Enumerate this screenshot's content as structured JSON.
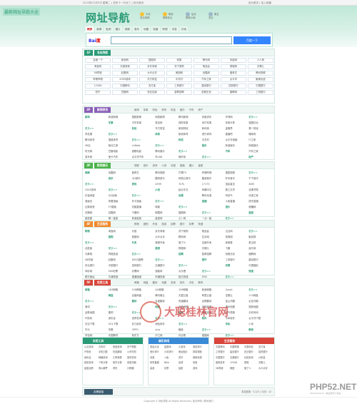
{
  "topbar": {
    "left": "2023年12月5日 星期二 | 农历十一月廿三 | 设为首页",
    "right": "设为首页 | 加入收藏"
  },
  "brand_corner": "最新网址导航大全",
  "title": "网址导航",
  "weather": [
    {
      "day": "今天",
      "desc": "多云转晴"
    },
    {
      "day": "明天",
      "desc": "晴转多云"
    },
    {
      "day": "后天",
      "desc": "阴转小雨"
    },
    {
      "day": "周五",
      "desc": "多云"
    }
  ],
  "nav_tabs": [
    "网页",
    "新闻",
    "贴吧",
    "图片",
    "视频",
    "音乐",
    "地图",
    "知道",
    "购物",
    "问答",
    "外卖"
  ],
  "search": {
    "logo_a": "Bai",
    "logo_b": "度",
    "placeholder": "",
    "button": "百度一下"
  },
  "famous": {
    "no": "1F",
    "title": "名站导航",
    "items": [
      "百度一下",
      "新浪网",
      "搜狐网",
      "网易",
      "腾讯网",
      "凤凰网",
      "人人网",
      "淘宝网",
      "天猫商城",
      "京东商城",
      "苏宁易购",
      "唯品会",
      "携程网",
      "去哪儿",
      "58同城",
      "赶集网",
      "大众点评",
      "美团网",
      "优酷网",
      "爱奇艺",
      "腾讯视频",
      "哔哩哔哩",
      "4399游戏",
      "东方财富",
      "中关村",
      "汽车之家",
      "太平洋",
      "聚美优品",
      "12306",
      "中国移动",
      "支付宝",
      "工商银行",
      "建设银行",
      "招商银行",
      "中国银行",
      "知乎",
      "豆瓣网",
      "世纪佳缘",
      "智联招聘",
      "前程无忧",
      "猎聘网",
      "工商银行"
    ]
  },
  "sections": [
    {
      "no": "2F",
      "title": "新闻资讯",
      "color": "#8a5fb8",
      "tabs": [
        "新闻",
        "军事",
        "财经",
        "体育",
        "科技",
        "娱乐",
        "汽车",
        "房产"
      ],
      "rows": [
        [
          "新闻",
          "新浪新闻",
          "搜狐新闻",
          "网易新闻",
          "腾讯新闻",
          "凤凰资讯",
          "环球网",
          "更多>>"
        ],
        [
          "军事",
          "中华军事",
          "铁血网",
          "西陆军事",
          "米尔军事",
          "军事头条",
          "强国论坛",
          "更多>>"
        ],
        [
          "财经",
          "东方财富",
          "新浪财经",
          "和讯网",
          "金融界",
          "第一财经",
          "同花顺",
          "更多>>"
        ],
        [
          "体育",
          "新浪体育",
          "虎扑体育",
          "直播吧",
          "懂球帝",
          "腾讯体育",
          "搜狐体育",
          "更多>>"
        ],
        [
          "科技",
          "中关村",
          "太平洋电脑",
          "IT之家",
          "36氪",
          "驱动之家",
          "cnBeta",
          "更多>>"
        ],
        [
          "娱乐",
          "新浪娱乐",
          "网易娱乐",
          "时光网",
          "豆瓣电影",
          "猫眼电影",
          "腾讯娱乐",
          "更多>>"
        ],
        [
          "汽车",
          "汽车之家",
          "易车网",
          "爱卡汽车",
          "太平洋汽车",
          "车168",
          "懂车帝",
          "更多>>"
        ],
        [
          "房产",
          "搜房网",
          "安居客",
          "链家网",
          "贝壳找房",
          "焦点房产",
          "乐居",
          "更多>>"
        ]
      ]
    },
    {
      "no": "3F",
      "title": "影视娱乐",
      "color": "#4cb34a",
      "tabs": [
        "视频",
        "音乐",
        "游戏",
        "小说",
        "动漫",
        "直播",
        "图片",
        "星座"
      ],
      "rows": [
        [
          "视频",
          "优酷网",
          "爱奇艺",
          "腾讯视频",
          "芒果TV",
          "哔哩哔哩",
          "搜狐视频",
          "更多>>"
        ],
        [
          "音乐",
          "QQ音乐",
          "酷狗音乐",
          "网易云音乐",
          "酷我音乐",
          "虾米音乐",
          "千千音乐",
          "更多>>"
        ],
        [
          "游戏",
          "4399",
          "7k7k",
          "17173",
          "游民星空",
          "3DM",
          "2345游戏",
          "更多>>"
        ],
        [
          "小说",
          "起点中文",
          "纵横中文",
          "晋江文学",
          "潇湘书院",
          "红袖添香",
          "QQ阅读",
          "更多>>"
        ],
        [
          "动漫",
          "腾讯动漫",
          "有妖气",
          "动漫之家",
          "漫画岛",
          "快看漫画",
          "布卡漫画",
          "更多>>"
        ],
        [
          "直播",
          "斗鱼直播",
          "虎牙直播",
          "企鹅电竞",
          "YY直播",
          "花椒直播",
          "映客",
          "更多>>"
        ],
        [
          "图片",
          "堆糖网",
          "花瓣网",
          "站酷网",
          "千图网",
          "昵图网",
          "摄图网",
          "更多>>"
        ],
        [
          "星座",
          "星座屋",
          "第一星座",
          "新浪星座",
          "星座网",
          "占卜网",
          "一点一星",
          "更多>>"
        ]
      ]
    },
    {
      "no": "4F",
      "title": "生活服务",
      "color": "#f08a2e",
      "tabs": [
        "购物",
        "团购",
        "外卖",
        "旅游",
        "招聘",
        "银行",
        "彩票",
        "快递"
      ],
      "rows": [
        [
          "购物",
          "淘宝网",
          "天猫",
          "京东商城",
          "苏宁易购",
          "唯品会",
          "当当网",
          "更多>>"
        ],
        [
          "团购",
          "美团网",
          "大众点评",
          "糯米网",
          "拉手网",
          "窝窝团",
          "聚划算",
          "更多>>"
        ],
        [
          "外卖",
          "美团外卖",
          "饿了么",
          "百度外卖",
          "肯德基",
          "麦当劳",
          "必胜客",
          "更多>>"
        ],
        [
          "旅游",
          "携程网",
          "去哪儿",
          "飞猪",
          "途牛网",
          "马蜂窝",
          "同程旅游",
          "更多>>"
        ],
        [
          "招聘",
          "智联招聘",
          "前程无忧",
          "猎聘网",
          "58同城",
          "赶集网",
          "BOSS直聘",
          "更多>>"
        ],
        [
          "银行",
          "工商银行",
          "建设银行",
          "农业银行",
          "中国银行",
          "招商银行",
          "交通银行",
          "更多>>"
        ],
        [
          "彩票",
          "中国福彩",
          "体彩网",
          "500彩票",
          "彩票网",
          "澳客网",
          "大乐透",
          "更多>>"
        ],
        [
          "快递",
          "顺丰速运",
          "中通快递",
          "圆通速递",
          "申通快递",
          "韵达快递",
          "EMS",
          "更多>>"
        ]
      ]
    },
    {
      "no": "5F",
      "title": "实用工具",
      "color": "#d9453a",
      "tabs": [
        "邮箱",
        "网盘",
        "翻译",
        "地图",
        "查询",
        "软件",
        "手机",
        "教育"
      ],
      "rows": [
        [
          "邮箱",
          "163邮箱",
          "126邮箱",
          "QQ邮箱",
          "139邮箱",
          "新浪邮箱",
          "Gmail",
          "更多>>"
        ],
        [
          "网盘",
          "百度网盘",
          "腾讯微云",
          "天翼云盘",
          "阿里云盘",
          "坚果云",
          "115网盘",
          "更多>>"
        ],
        [
          "翻译",
          "百度翻译",
          "有道翻译",
          "谷歌翻译",
          "金山词霸",
          "必应词典",
          "海词",
          "更多>>"
        ],
        [
          "地图",
          "百度地图",
          "高德地图",
          "腾讯地图",
          "搜狗地图",
          "谷歌地图",
          "图吧",
          "更多>>"
        ],
        [
          "查询",
          "快递查询",
          "天气预报",
          "手机号码",
          "IP查询",
          "身份证",
          "违章查询",
          "更多>>"
        ],
        [
          "软件",
          "华军软件",
          "太平洋下载",
          "天空下载",
          "ZOL下载",
          "非凡软件",
          "绿色软件",
          "更多>>"
        ],
        [
          "手机",
          "小米",
          "华为",
          "苹果",
          "OPPO",
          "vivo",
          "魅族",
          "更多>>"
        ],
        [
          "教育",
          "学信网",
          "中国教育",
          "新东方",
          "沪江网",
          "作业帮",
          "猿题库",
          "更多>>"
        ]
      ]
    }
  ],
  "panels": [
    {
      "title": "实用工具",
      "color": "#2a9a76",
      "items": [
        "公交查询",
        "万年历",
        "快递查询",
        "天气预报",
        "IP查询",
        "手机归属",
        "在线翻译",
        "火车时刻",
        "身份证",
        "邮编查询",
        "汇率换算",
        "违章查询",
        "航班查询",
        "个税计算",
        "房贷计算",
        "成语词典",
        "星座运势",
        "周公解梦",
        "黄历",
        "计算器"
      ]
    },
    {
      "title": "娱乐休闲",
      "color": "#3a8ad6",
      "items": [
        "笑话大全",
        "星座网",
        "小游戏",
        "电影排行",
        "音乐排行",
        "小说排行",
        "美女图片",
        "搞笑视频",
        "动漫",
        "斗鱼",
        "虎牙",
        "网络电视",
        "体育直播",
        "NBA",
        "足球",
        "电竞",
        "桌游",
        "彩票",
        "抽奖",
        "游戏"
      ]
    },
    {
      "title": "生活服务",
      "color": "#d9453a",
      "items": [
        "中国移动",
        "中国联通",
        "中国电信",
        "支付宝",
        "工商银行",
        "建设银行",
        "农业银行",
        "招商银行",
        "中国银行",
        "交通银行",
        "社保查询",
        "公积金",
        "医院挂号",
        "12306",
        "携程",
        "去哪儿",
        "58同城",
        "美团",
        "饿了么",
        "大众点评"
      ]
    }
  ],
  "friend": {
    "title": "友情链接",
    "right": "本站收录：3,127 | 今日：12"
  },
  "footer": "Copyright © 网址导航 All Rights Reserved | 免责声明 | 联系我们",
  "watermark": {
    "text": "大聪桂林官网",
    "site": "PHP52.NET",
    "sub": "ZHANGZUAN · 精品源码下载站"
  }
}
